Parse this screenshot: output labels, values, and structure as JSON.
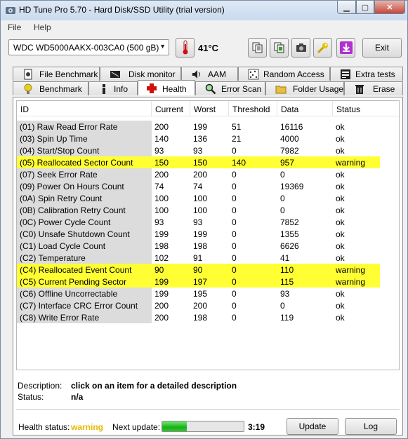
{
  "window": {
    "title": "HD Tune Pro 5.70 - Hard Disk/SSD Utility (trial version)",
    "min": "▁",
    "max": "▢",
    "close": "✕"
  },
  "menu": {
    "file": "File",
    "help": "Help"
  },
  "toolbar": {
    "drive": "WDC WD5000AAKX-003CA0 (500 gB)",
    "temperature": "41°C",
    "exit": "Exit"
  },
  "tabs_top": [
    {
      "label": "File Benchmark",
      "icon": "file-benchmark-icon"
    },
    {
      "label": "Disk monitor",
      "icon": "disk-monitor-icon"
    },
    {
      "label": "AAM",
      "icon": "speaker-icon"
    },
    {
      "label": "Random Access",
      "icon": "random-access-icon"
    },
    {
      "label": "Extra tests",
      "icon": "extra-tests-icon"
    }
  ],
  "tabs_bottom": [
    {
      "label": "Benchmark",
      "icon": "lightbulb-icon"
    },
    {
      "label": "Info",
      "icon": "info-icon"
    },
    {
      "label": "Health",
      "icon": "red-cross-icon"
    },
    {
      "label": "Error Scan",
      "icon": "magnifier-icon"
    },
    {
      "label": "Folder Usage",
      "icon": "folder-icon"
    },
    {
      "label": "Erase",
      "icon": "trash-icon"
    }
  ],
  "colors": {
    "warning_row": "#ffff33",
    "warning_text": "#e6b800",
    "id_cell": "#dcdcdc"
  },
  "table": {
    "columns": [
      "ID",
      "Current",
      "Worst",
      "Threshold",
      "Data",
      "Status"
    ],
    "rows": [
      {
        "id": "(01) Raw Read Error Rate",
        "current": "200",
        "worst": "199",
        "threshold": "51",
        "data": "16116",
        "status": "ok",
        "warn": false
      },
      {
        "id": "(03) Spin Up Time",
        "current": "140",
        "worst": "136",
        "threshold": "21",
        "data": "4000",
        "status": "ok",
        "warn": false
      },
      {
        "id": "(04) Start/Stop Count",
        "current": "93",
        "worst": "93",
        "threshold": "0",
        "data": "7982",
        "status": "ok",
        "warn": false
      },
      {
        "id": "(05) Reallocated Sector Count",
        "current": "150",
        "worst": "150",
        "threshold": "140",
        "data": "957",
        "status": "warning",
        "warn": true
      },
      {
        "id": "(07) Seek Error Rate",
        "current": "200",
        "worst": "200",
        "threshold": "0",
        "data": "0",
        "status": "ok",
        "warn": false
      },
      {
        "id": "(09) Power On Hours Count",
        "current": "74",
        "worst": "74",
        "threshold": "0",
        "data": "19369",
        "status": "ok",
        "warn": false
      },
      {
        "id": "(0A) Spin Retry Count",
        "current": "100",
        "worst": "100",
        "threshold": "0",
        "data": "0",
        "status": "ok",
        "warn": false
      },
      {
        "id": "(0B) Calibration Retry Count",
        "current": "100",
        "worst": "100",
        "threshold": "0",
        "data": "0",
        "status": "ok",
        "warn": false
      },
      {
        "id": "(0C) Power Cycle Count",
        "current": "93",
        "worst": "93",
        "threshold": "0",
        "data": "7852",
        "status": "ok",
        "warn": false
      },
      {
        "id": "(C0) Unsafe Shutdown Count",
        "current": "199",
        "worst": "199",
        "threshold": "0",
        "data": "1355",
        "status": "ok",
        "warn": false
      },
      {
        "id": "(C1) Load Cycle Count",
        "current": "198",
        "worst": "198",
        "threshold": "0",
        "data": "6626",
        "status": "ok",
        "warn": false
      },
      {
        "id": "(C2) Temperature",
        "current": "102",
        "worst": "91",
        "threshold": "0",
        "data": "41",
        "status": "ok",
        "warn": false
      },
      {
        "id": "(C4) Reallocated Event Count",
        "current": "90",
        "worst": "90",
        "threshold": "0",
        "data": "110",
        "status": "warning",
        "warn": true
      },
      {
        "id": "(C5) Current Pending Sector",
        "current": "199",
        "worst": "197",
        "threshold": "0",
        "data": "115",
        "status": "warning",
        "warn": true
      },
      {
        "id": "(C6) Offline Uncorrectable",
        "current": "199",
        "worst": "195",
        "threshold": "0",
        "data": "93",
        "status": "ok",
        "warn": false
      },
      {
        "id": "(C7) Interface CRC Error Count",
        "current": "200",
        "worst": "200",
        "threshold": "0",
        "data": "0",
        "status": "ok",
        "warn": false
      },
      {
        "id": "(C8) Write Error Rate",
        "current": "200",
        "worst": "198",
        "threshold": "0",
        "data": "119",
        "status": "ok",
        "warn": false
      }
    ]
  },
  "details": {
    "description_label": "Description:",
    "description_value": "click on an item for a detailed description",
    "status_label": "Status:",
    "status_value": "n/a"
  },
  "footer": {
    "health_label": "Health status:",
    "health_value": "warning",
    "next_update_label": "Next update:",
    "progress": 0.3,
    "time": "3:19",
    "update_button": "Update",
    "log_button": "Log"
  }
}
